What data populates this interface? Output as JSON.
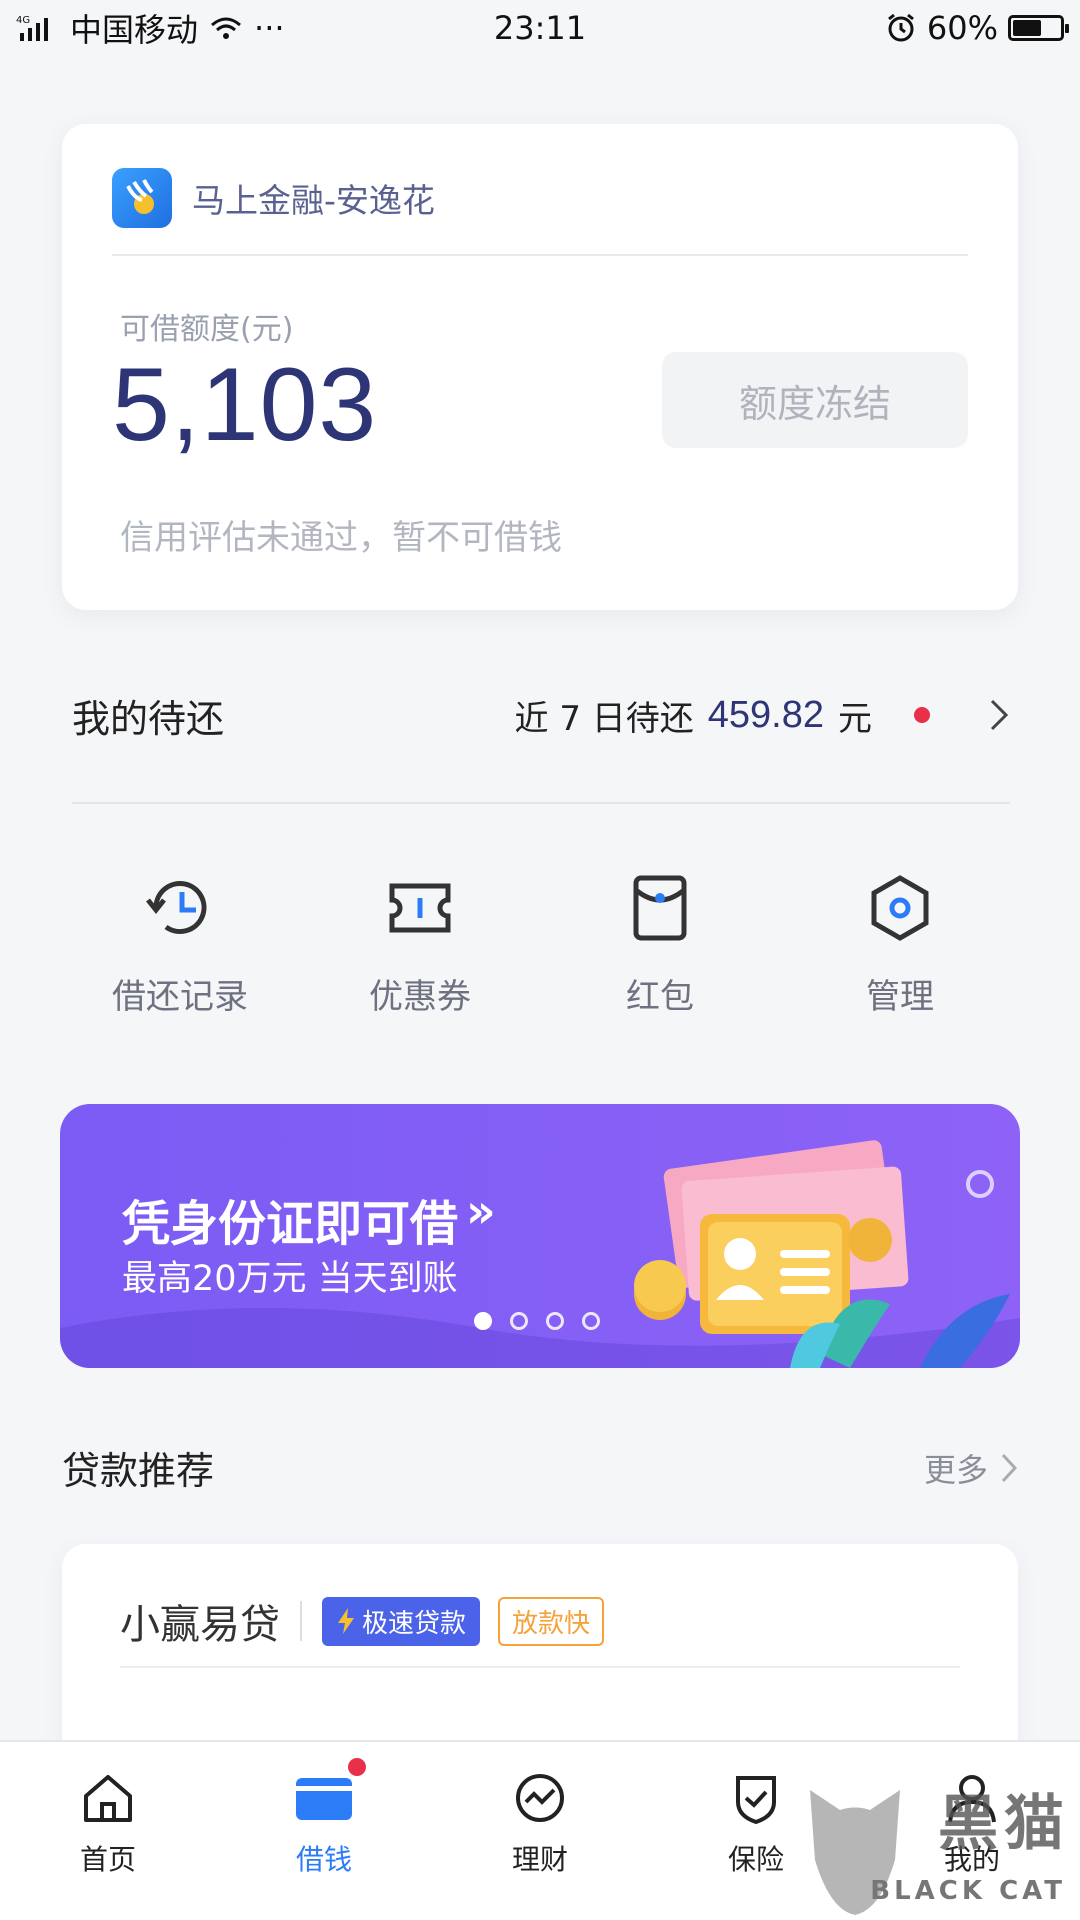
{
  "status_bar": {
    "network": "4G",
    "carrier": "中国移动",
    "time": "23:11",
    "battery": "60%",
    "battery_level": 0.6
  },
  "credit_card": {
    "app_name": "马上金融-安逸花",
    "credit_label": "可借额度(元)",
    "credit_amount": "5,103",
    "status_button": "额度冻结",
    "note": "信用评估未通过，暂不可借钱"
  },
  "repayment": {
    "title": "我的待还",
    "prefix": "近 7 日待还",
    "amount": "459.82",
    "unit": "元"
  },
  "quick_actions": [
    {
      "label": "借还记录",
      "icon": "history-icon"
    },
    {
      "label": "优惠券",
      "icon": "coupon-icon"
    },
    {
      "label": "红包",
      "icon": "red-packet-icon"
    },
    {
      "label": "管理",
      "icon": "settings-hexagon-icon"
    }
  ],
  "banner": {
    "title": "凭身份证即可借",
    "arrows": "»",
    "subtitle": "最高20万元  当天到账",
    "slide_count": 4,
    "active_slide": 1
  },
  "loan_section": {
    "title": "贷款推荐",
    "more": "更多"
  },
  "loan_card": {
    "name": "小赢易贷",
    "tag_fast": "极速贷款",
    "tag_quick": "放款快"
  },
  "tab_bar": {
    "tabs": [
      {
        "label": "首页",
        "icon": "home-icon",
        "active": false
      },
      {
        "label": "借钱",
        "icon": "card-icon",
        "active": true
      },
      {
        "label": "理财",
        "icon": "chart-icon",
        "active": false
      },
      {
        "label": "保险",
        "icon": "shield-icon",
        "active": false
      },
      {
        "label": "我的",
        "icon": "user-icon",
        "active": false
      }
    ]
  },
  "watermark": {
    "text": "黑猫",
    "sub": "BLACK CAT"
  },
  "colors": {
    "accent": "#2b7cf6",
    "amount": "#2e3577",
    "banner": "#7b5cf5",
    "alert": "#e8304a",
    "tag_orange": "#f5a23b"
  }
}
